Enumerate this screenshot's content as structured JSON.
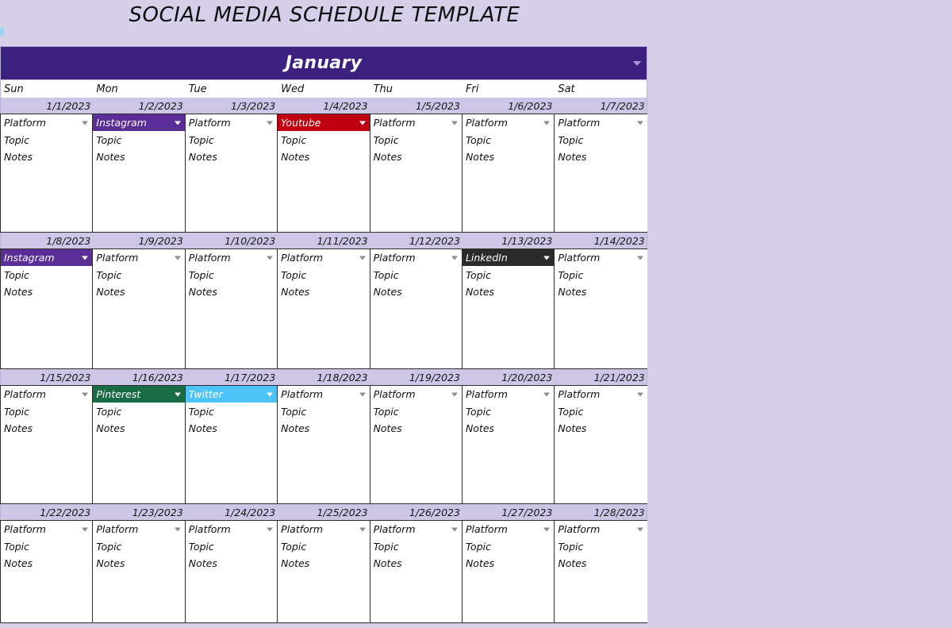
{
  "page": {
    "title": "SOCIAL MEDIA SCHEDULE TEMPLATE",
    "background_color": "#d5cfea"
  },
  "calendar": {
    "month": "January",
    "month_bar_color": "#3b2080",
    "day_headers": [
      "Sun",
      "Mon",
      "Tue",
      "Wed",
      "Thu",
      "Fri",
      "Sat"
    ],
    "cell_labels": {
      "platform_placeholder": "Platform",
      "topic": "Topic",
      "notes": "Notes"
    },
    "platform_colors": {
      "Instagram": "#5b2d96",
      "Youtube": "#c00011",
      "LinkedIn": "#2b2b2b",
      "Pinterest": "#176b45",
      "Twitter": "#4ec3f7",
      "Platform": "#ffffff"
    },
    "weeks": [
      {
        "dates": [
          "1/1/2023",
          "1/2/2023",
          "1/3/2023",
          "1/4/2023",
          "1/5/2023",
          "1/6/2023",
          "1/7/2023"
        ],
        "cells": [
          {
            "platform": "Platform",
            "topic": "Topic",
            "notes": "Notes"
          },
          {
            "platform": "Instagram",
            "topic": "Topic",
            "notes": "Notes"
          },
          {
            "platform": "Platform",
            "topic": "Topic",
            "notes": "Notes"
          },
          {
            "platform": "Youtube",
            "topic": "Topic",
            "notes": "Notes"
          },
          {
            "platform": "Platform",
            "topic": "Topic",
            "notes": "Notes"
          },
          {
            "platform": "Platform",
            "topic": "Topic",
            "notes": "Notes"
          },
          {
            "platform": "Platform",
            "topic": "Topic",
            "notes": "Notes"
          }
        ]
      },
      {
        "dates": [
          "1/8/2023",
          "1/9/2023",
          "1/10/2023",
          "1/11/2023",
          "1/12/2023",
          "1/13/2023",
          "1/14/2023"
        ],
        "cells": [
          {
            "platform": "Instagram",
            "topic": "Topic",
            "notes": "Notes"
          },
          {
            "platform": "Platform",
            "topic": "Topic",
            "notes": "Notes"
          },
          {
            "platform": "Platform",
            "topic": "Topic",
            "notes": "Notes"
          },
          {
            "platform": "Platform",
            "topic": "Topic",
            "notes": "Notes"
          },
          {
            "platform": "Platform",
            "topic": "Topic",
            "notes": "Notes"
          },
          {
            "platform": "LinkedIn",
            "topic": "Topic",
            "notes": "Notes"
          },
          {
            "platform": "Platform",
            "topic": "Topic",
            "notes": "Notes"
          }
        ]
      },
      {
        "dates": [
          "1/15/2023",
          "1/16/2023",
          "1/17/2023",
          "1/18/2023",
          "1/19/2023",
          "1/20/2023",
          "1/21/2023"
        ],
        "cells": [
          {
            "platform": "Platform",
            "topic": "Topic",
            "notes": "Notes"
          },
          {
            "platform": "Pinterest",
            "topic": "Topic",
            "notes": "Notes"
          },
          {
            "platform": "Twitter",
            "topic": "Topic",
            "notes": "Notes"
          },
          {
            "platform": "Platform",
            "topic": "Topic",
            "notes": "Notes"
          },
          {
            "platform": "Platform",
            "topic": "Topic",
            "notes": "Notes"
          },
          {
            "platform": "Platform",
            "topic": "Topic",
            "notes": "Notes"
          },
          {
            "platform": "Platform",
            "topic": "Topic",
            "notes": "Notes"
          }
        ]
      },
      {
        "dates": [
          "1/22/2023",
          "1/23/2023",
          "1/24/2023",
          "1/25/2023",
          "1/26/2023",
          "1/27/2023",
          "1/28/2023"
        ],
        "cells": [
          {
            "platform": "Platform",
            "topic": "Topic",
            "notes": "Notes"
          },
          {
            "platform": "Platform",
            "topic": "Topic",
            "notes": "Notes"
          },
          {
            "platform": "Platform",
            "topic": "Topic",
            "notes": "Notes"
          },
          {
            "platform": "Platform",
            "topic": "Topic",
            "notes": "Notes"
          },
          {
            "platform": "Platform",
            "topic": "Topic",
            "notes": "Notes"
          },
          {
            "platform": "Platform",
            "topic": "Topic",
            "notes": "Notes"
          },
          {
            "platform": "Platform",
            "topic": "Topic",
            "notes": "Notes"
          }
        ]
      }
    ],
    "week_heights": [
      150,
      152,
      150,
      130
    ]
  }
}
